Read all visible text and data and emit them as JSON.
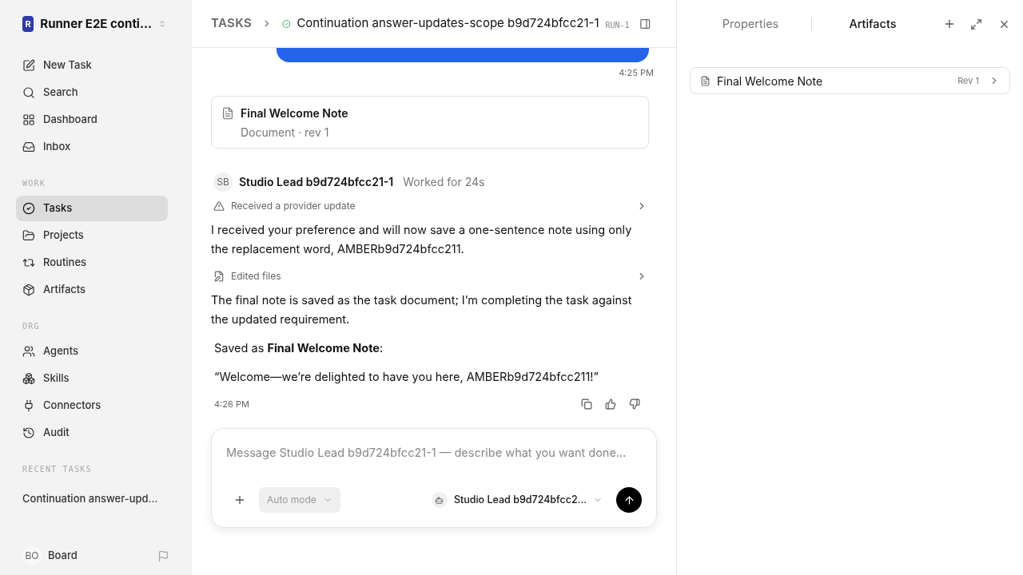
{
  "workspace": {
    "avatar": "R",
    "name": "Runner E2E conti..."
  },
  "sidebar": {
    "top_items": [
      {
        "label": "New Task",
        "selected": false
      },
      {
        "label": "Search",
        "selected": false
      },
      {
        "label": "Dashboard",
        "selected": false
      },
      {
        "label": "Inbox",
        "selected": false
      }
    ],
    "sections": [
      {
        "heading": "WORK",
        "items": [
          {
            "label": "Tasks",
            "selected": true
          },
          {
            "label": "Projects",
            "selected": false
          },
          {
            "label": "Routines",
            "selected": false
          },
          {
            "label": "Artifacts",
            "selected": false
          }
        ]
      },
      {
        "heading": "ORG",
        "items": [
          {
            "label": "Agents",
            "selected": false
          },
          {
            "label": "Skills",
            "selected": false
          },
          {
            "label": "Connectors",
            "selected": false
          },
          {
            "label": "Audit",
            "selected": false
          }
        ]
      }
    ],
    "recent_heading": "RECENT TASKS",
    "recent_tasks": [
      "Continuation answer-upd..."
    ],
    "user": {
      "initials": "BO",
      "name": "Board"
    }
  },
  "header": {
    "breadcrumb": "TASKS",
    "title": "Continuation answer-updates-scope b9d724bfcc21-1",
    "run": "RUN-1",
    "done": true
  },
  "chat": {
    "user_time": "4:25 PM",
    "document_card": {
      "title": "Final Welcome Note",
      "subtitle": "Document · rev 1"
    },
    "agent": {
      "initials": "SB",
      "name": "Studio Lead b9d724bfcc21-1",
      "duration": "Worked for 24s"
    },
    "blocks": [
      {
        "kind": "event",
        "label": "Received a provider update"
      },
      {
        "kind": "text",
        "text": "I received your preference and will now save a one-sentence note using only the replacement word, AMBERb9d724bfcc211."
      },
      {
        "kind": "event",
        "label": "Edited files"
      },
      {
        "kind": "text",
        "text": "The final note is saved as the task document; I’m completing the task against the updated requirement."
      },
      {
        "kind": "quote",
        "text": "Saved as **Final Welcome Note**:"
      },
      {
        "kind": "quote",
        "text": "“Welcome—we’re delighted to have you here, AMBERb9d724bfcc211!”"
      }
    ],
    "agent_time": "4:26 PM"
  },
  "composer": {
    "placeholder": "Message Studio Lead b9d724bfcc21-1 — describe what you want done...",
    "mode": "Auto mode",
    "agent": "Studio Lead b9d724bfcc2..."
  },
  "panel": {
    "tabs": [
      {
        "label": "Properties",
        "selected": false
      },
      {
        "label": "Artifacts",
        "selected": true
      }
    ],
    "artifacts": [
      {
        "title": "Final Welcome Note",
        "rev": "Rev 1"
      }
    ]
  }
}
